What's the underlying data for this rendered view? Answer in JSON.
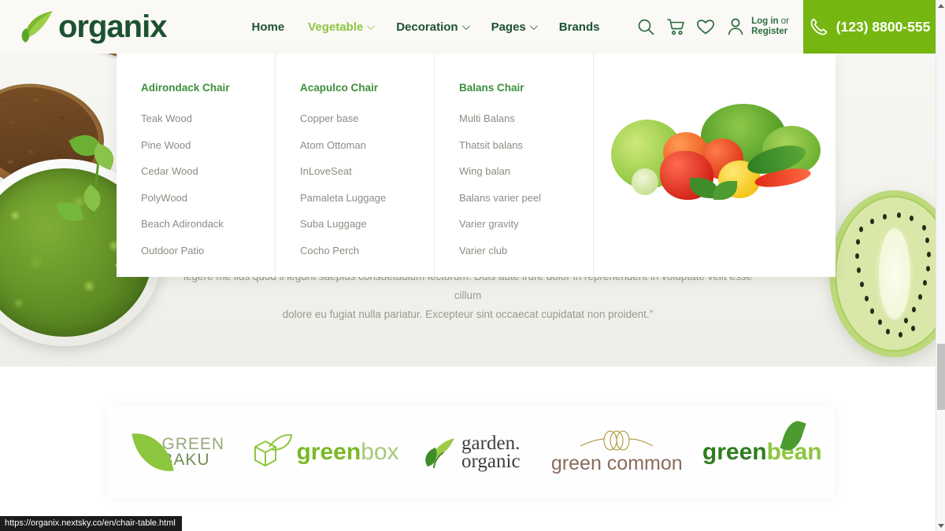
{
  "brand": {
    "name": "organix",
    "logo_icon": "leaf-icon"
  },
  "nav": {
    "items": [
      {
        "label": "Home",
        "has_caret": false,
        "active": false
      },
      {
        "label": "Vegetable",
        "has_caret": true,
        "active": true
      },
      {
        "label": "Decoration",
        "has_caret": true,
        "active": false
      },
      {
        "label": "Pages",
        "has_caret": true,
        "active": false
      },
      {
        "label": "Brands",
        "has_caret": false,
        "active": false
      }
    ]
  },
  "header_actions": {
    "search_icon": "search-icon",
    "cart_icon": "shopping-cart-icon",
    "wishlist_icon": "heart-icon",
    "user_icon": "user-icon",
    "account_line1": "Log in",
    "account_or": "or",
    "account_line2": "Register",
    "phone_icon": "phone-icon",
    "phone_number": "(123) 8800-555"
  },
  "mega_menu": {
    "columns": [
      {
        "title": "Adirondack Chair",
        "links": [
          "Teak Wood",
          "Pine Wood",
          "Cedar Wood",
          "PolyWood",
          "Beach Adirondack",
          "Outdoor Patio"
        ]
      },
      {
        "title": "Acapulco Chair",
        "links": [
          "Copper base",
          "Atom Ottoman",
          "InLoveSeat",
          "Pamaleta Luggage",
          "Suba Luggage",
          "Cocho Perch"
        ]
      },
      {
        "title": "Balans Chair",
        "links": [
          "Multi Balans",
          "Thatsit balans",
          "Wing balan",
          "Balans varier peel",
          "Varier gravity",
          "Varier club"
        ]
      }
    ],
    "promo_image": "assorted-vegetables-image"
  },
  "hero": {
    "image": "pesto-bowl-flaxseed-spoon-kiwi-photo",
    "quote_line1": "legere me lius quod ii legunt saepius consuetudium lectorum. Duis aute irure dolor in reprehenderit in voluptate velit esse cillum",
    "quote_line2": "dolore eu fugiat nulla pariatur. Excepteur sint occaecat cupidatat non proident.\""
  },
  "brands": {
    "items": [
      {
        "name": "GREEN BAKU",
        "line1": "GREEN",
        "line2": "BAKU"
      },
      {
        "name": "greenbox",
        "bold": "green",
        "light": "box"
      },
      {
        "name": "garden organic",
        "line1": "garden.",
        "line2": "organic"
      },
      {
        "name": "green common",
        "label": "green common"
      },
      {
        "name": "greenbean",
        "bold": "green",
        "light": "bean"
      }
    ]
  },
  "status_bar": {
    "url": "https://organix.nextsky.co/en/chair-table.html"
  },
  "colors": {
    "primary_green": "#76b610",
    "dark_green": "#1d5130",
    "accent_green": "#8cc63e",
    "menu_title_green": "#3d8f3d",
    "muted_text": "#8c8c84"
  },
  "scrollbar": {
    "up_icon": "caret-up-icon",
    "down_icon": "caret-down-icon"
  }
}
